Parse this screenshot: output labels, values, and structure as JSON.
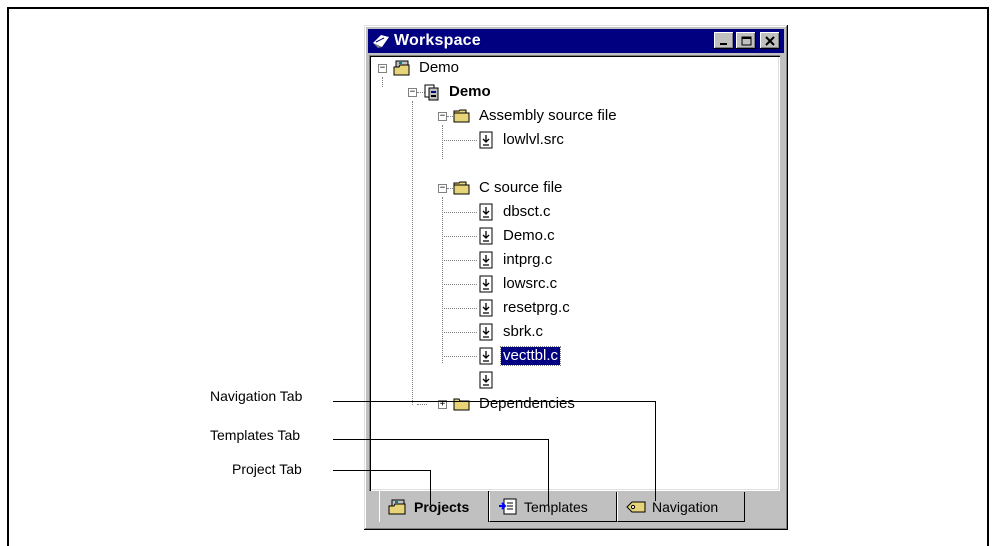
{
  "window": {
    "title": "Workspace",
    "controls": [
      "minimize",
      "maximize",
      "close"
    ]
  },
  "tree": {
    "root": {
      "label": "Demo"
    },
    "project": {
      "label": "Demo"
    },
    "folders": [
      {
        "label": "Assembly source file",
        "files": [
          "lowlvl.src"
        ]
      },
      {
        "label": "C source file",
        "files": [
          "dbsct.c",
          "Demo.c",
          "intprg.c",
          "lowsrc.c",
          "resetprg.c",
          "sbrk.c",
          "vecttbl.c"
        ]
      },
      {
        "label": "Dependencies",
        "files": []
      }
    ],
    "selected_file": "sbrk.c"
  },
  "tabs": [
    {
      "label": "Projects",
      "active": true,
      "icon": "projects-icon"
    },
    {
      "label": "Templates",
      "active": false,
      "icon": "templates-icon"
    },
    {
      "label": "Navigation",
      "active": false,
      "icon": "navigation-icon"
    }
  ],
  "callouts": {
    "navigation": "Navigation Tab",
    "templates": "Templates Tab",
    "project": "Project Tab"
  },
  "colors": {
    "titlebar": "#000080",
    "selection": "#000080",
    "window_face": "#c0c0c0",
    "folder": "#e8d478"
  }
}
